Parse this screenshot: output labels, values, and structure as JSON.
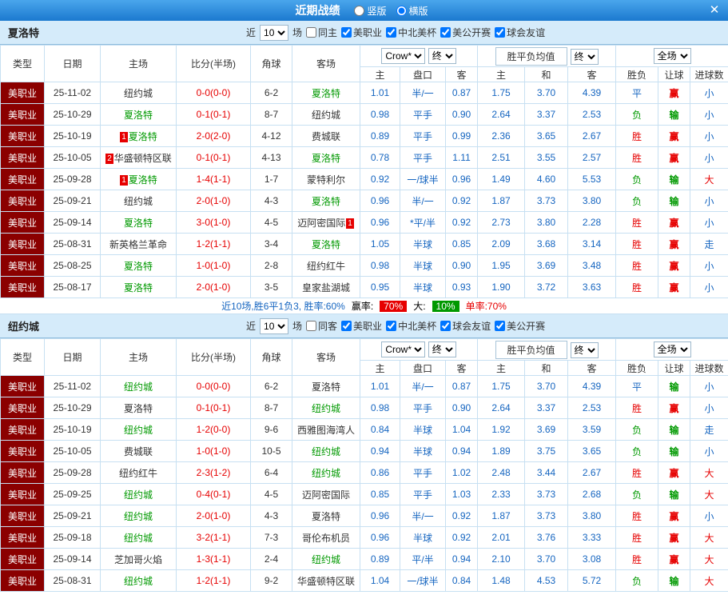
{
  "topbar": {
    "title": "近期战绩",
    "radio_vertical": "竖版",
    "radio_horizontal": "横版",
    "close": "✕"
  },
  "table_header": {
    "col_type": "类型",
    "col_date": "日期",
    "col_home": "主场",
    "col_score": "比分(半场)",
    "col_corner": "角球",
    "col_away": "客场",
    "odds_source": "Crow*",
    "odds_final": "终",
    "europe_label": "胜平负均值",
    "europe_final": "终",
    "scope": "全场",
    "sub_home": "主",
    "sub_handicap": "盘口",
    "sub_away": "客",
    "sub_win": "主",
    "sub_draw": "和",
    "sub_lose": "客",
    "sub_result": "胜负",
    "sub_handicap_result": "让球",
    "sub_goals": "进球数"
  },
  "sections": [
    {
      "team": "夏洛特",
      "filter": {
        "near": "近",
        "count": "10",
        "matches": "场",
        "same_venue": "同主",
        "leagues": [
          "美职业",
          "中北美杯",
          "美公开赛",
          "球会友谊"
        ]
      },
      "rows": [
        {
          "type": "美职业",
          "date": "25-11-02",
          "home": "纽约城",
          "home_rank": "",
          "score": "0-0(0-0)",
          "corner": "6-2",
          "away": "夏洛特",
          "away_rank": "",
          "h": "1.01",
          "hcap": "半/一",
          "a": "0.87",
          "w": "1.75",
          "d": "3.70",
          "l": "4.39",
          "res": "平",
          "hres": "赢",
          "gres": "小"
        },
        {
          "type": "美职业",
          "date": "25-10-29",
          "home": "夏洛特",
          "home_rank": "",
          "score": "0-1(0-1)",
          "corner": "8-7",
          "away": "纽约城",
          "away_rank": "",
          "h": "0.98",
          "hcap": "平手",
          "a": "0.90",
          "w": "2.64",
          "d": "3.37",
          "l": "2.53",
          "res": "负",
          "hres": "输",
          "gres": "小"
        },
        {
          "type": "美职业",
          "date": "25-10-19",
          "home": "夏洛特",
          "home_rank": "1",
          "score": "2-0(2-0)",
          "corner": "4-12",
          "away": "费城联",
          "away_rank": "",
          "h": "0.89",
          "hcap": "平手",
          "a": "0.99",
          "w": "2.36",
          "d": "3.65",
          "l": "2.67",
          "res": "胜",
          "hres": "赢",
          "gres": "小"
        },
        {
          "type": "美职业",
          "date": "25-10-05",
          "home": "华盛顿特区联",
          "home_rank": "2",
          "score": "0-1(0-1)",
          "corner": "4-13",
          "away": "夏洛特",
          "away_rank": "",
          "h": "0.78",
          "hcap": "平手",
          "a": "1.11",
          "w": "2.51",
          "d": "3.55",
          "l": "2.57",
          "res": "胜",
          "hres": "赢",
          "gres": "小"
        },
        {
          "type": "美职业",
          "date": "25-09-28",
          "home": "夏洛特",
          "home_rank": "1",
          "score": "1-4(1-1)",
          "corner": "1-7",
          "away": "蒙特利尔",
          "away_rank": "",
          "h": "0.92",
          "hcap": "一/球半",
          "a": "0.96",
          "w": "1.49",
          "d": "4.60",
          "l": "5.53",
          "res": "负",
          "hres": "输",
          "gres": "大"
        },
        {
          "type": "美职业",
          "date": "25-09-21",
          "home": "纽约城",
          "home_rank": "",
          "score": "2-0(1-0)",
          "corner": "4-3",
          "away": "夏洛特",
          "away_rank": "",
          "h": "0.96",
          "hcap": "半/一",
          "a": "0.92",
          "w": "1.87",
          "d": "3.73",
          "l": "3.80",
          "res": "负",
          "hres": "输",
          "gres": "小"
        },
        {
          "type": "美职业",
          "date": "25-09-14",
          "home": "夏洛特",
          "home_rank": "",
          "score": "3-0(1-0)",
          "corner": "4-5",
          "away": "迈阿密国际",
          "away_rank": "1",
          "h": "0.96",
          "hcap": "*平/半",
          "a": "0.92",
          "w": "2.73",
          "d": "3.80",
          "l": "2.28",
          "res": "胜",
          "hres": "赢",
          "gres": "小"
        },
        {
          "type": "美职业",
          "date": "25-08-31",
          "home": "新英格兰革命",
          "home_rank": "",
          "score": "1-2(1-1)",
          "corner": "3-4",
          "away": "夏洛特",
          "away_rank": "",
          "h": "1.05",
          "hcap": "半球",
          "a": "0.85",
          "w": "2.09",
          "d": "3.68",
          "l": "3.14",
          "res": "胜",
          "hres": "赢",
          "gres": "走"
        },
        {
          "type": "美职业",
          "date": "25-08-25",
          "home": "夏洛特",
          "home_rank": "",
          "score": "1-0(1-0)",
          "corner": "2-8",
          "away": "纽约红牛",
          "away_rank": "",
          "h": "0.98",
          "hcap": "半球",
          "a": "0.90",
          "w": "1.95",
          "d": "3.69",
          "l": "3.48",
          "res": "胜",
          "hres": "赢",
          "gres": "小"
        },
        {
          "type": "美职业",
          "date": "25-08-17",
          "home": "夏洛特",
          "home_rank": "",
          "score": "2-0(1-0)",
          "corner": "3-5",
          "away": "皇家盐湖城",
          "away_rank": "",
          "h": "0.95",
          "hcap": "半球",
          "a": "0.93",
          "w": "1.90",
          "d": "3.72",
          "l": "3.63",
          "res": "胜",
          "hres": "赢",
          "gres": "小"
        }
      ],
      "summary": {
        "record": "近10场,胜6平1负3, 胜率:60%",
        "win_rate_label": "赢率:",
        "win_rate": "70%",
        "big_label": "大:",
        "big_rate": "10%",
        "single_rate": "单率:70%"
      }
    },
    {
      "team": "纽约城",
      "filter": {
        "near": "近",
        "count": "10",
        "matches": "场",
        "same_venue": "同客",
        "leagues": [
          "美职业",
          "中北美杯",
          "球会友谊",
          "美公开赛"
        ]
      },
      "rows": [
        {
          "type": "美职业",
          "date": "25-11-02",
          "home": "纽约城",
          "home_rank": "",
          "score": "0-0(0-0)",
          "corner": "6-2",
          "away": "夏洛特",
          "away_rank": "",
          "h": "1.01",
          "hcap": "半/一",
          "a": "0.87",
          "w": "1.75",
          "d": "3.70",
          "l": "4.39",
          "res": "平",
          "hres": "输",
          "gres": "小"
        },
        {
          "type": "美职业",
          "date": "25-10-29",
          "home": "夏洛特",
          "home_rank": "",
          "score": "0-1(0-1)",
          "corner": "8-7",
          "away": "纽约城",
          "away_rank": "",
          "h": "0.98",
          "hcap": "平手",
          "a": "0.90",
          "w": "2.64",
          "d": "3.37",
          "l": "2.53",
          "res": "胜",
          "hres": "赢",
          "gres": "小"
        },
        {
          "type": "美职业",
          "date": "25-10-19",
          "home": "纽约城",
          "home_rank": "",
          "score": "1-2(0-0)",
          "corner": "9-6",
          "away": "西雅图海湾人",
          "away_rank": "",
          "h": "0.84",
          "hcap": "半球",
          "a": "1.04",
          "w": "1.92",
          "d": "3.69",
          "l": "3.59",
          "res": "负",
          "hres": "输",
          "gres": "走"
        },
        {
          "type": "美职业",
          "date": "25-10-05",
          "home": "费城联",
          "home_rank": "",
          "score": "1-0(1-0)",
          "corner": "10-5",
          "away": "纽约城",
          "away_rank": "",
          "h": "0.94",
          "hcap": "半球",
          "a": "0.94",
          "w": "1.89",
          "d": "3.75",
          "l": "3.65",
          "res": "负",
          "hres": "输",
          "gres": "小"
        },
        {
          "type": "美职业",
          "date": "25-09-28",
          "home": "纽约红牛",
          "home_rank": "",
          "score": "2-3(1-2)",
          "corner": "6-4",
          "away": "纽约城",
          "away_rank": "",
          "h": "0.86",
          "hcap": "平手",
          "a": "1.02",
          "w": "2.48",
          "d": "3.44",
          "l": "2.67",
          "res": "胜",
          "hres": "赢",
          "gres": "大"
        },
        {
          "type": "美职业",
          "date": "25-09-25",
          "home": "纽约城",
          "home_rank": "",
          "score": "0-4(0-1)",
          "corner": "4-5",
          "away": "迈阿密国际",
          "away_rank": "",
          "h": "0.85",
          "hcap": "平手",
          "a": "1.03",
          "w": "2.33",
          "d": "3.73",
          "l": "2.68",
          "res": "负",
          "hres": "输",
          "gres": "大"
        },
        {
          "type": "美职业",
          "date": "25-09-21",
          "home": "纽约城",
          "home_rank": "",
          "score": "2-0(1-0)",
          "corner": "4-3",
          "away": "夏洛特",
          "away_rank": "",
          "h": "0.96",
          "hcap": "半/一",
          "a": "0.92",
          "w": "1.87",
          "d": "3.73",
          "l": "3.80",
          "res": "胜",
          "hres": "赢",
          "gres": "小"
        },
        {
          "type": "美职业",
          "date": "25-09-18",
          "home": "纽约城",
          "home_rank": "",
          "score": "3-2(1-1)",
          "corner": "7-3",
          "away": "哥伦布机员",
          "away_rank": "",
          "h": "0.96",
          "hcap": "半球",
          "a": "0.92",
          "w": "2.01",
          "d": "3.76",
          "l": "3.33",
          "res": "胜",
          "hres": "赢",
          "gres": "大"
        },
        {
          "type": "美职业",
          "date": "25-09-14",
          "home": "芝加哥火焰",
          "home_rank": "",
          "score": "1-3(1-1)",
          "corner": "2-4",
          "away": "纽约城",
          "away_rank": "",
          "h": "0.89",
          "hcap": "平/半",
          "a": "0.94",
          "w": "2.10",
          "d": "3.70",
          "l": "3.08",
          "res": "胜",
          "hres": "赢",
          "gres": "大"
        },
        {
          "type": "美职业",
          "date": "25-08-31",
          "home": "纽约城",
          "home_rank": "",
          "score": "1-2(1-1)",
          "corner": "9-2",
          "away": "华盛顿特区联",
          "away_rank": "",
          "h": "1.04",
          "hcap": "一/球半",
          "a": "0.84",
          "w": "1.48",
          "d": "4.53",
          "l": "5.72",
          "res": "负",
          "hres": "输",
          "gres": "大"
        }
      ]
    }
  ]
}
